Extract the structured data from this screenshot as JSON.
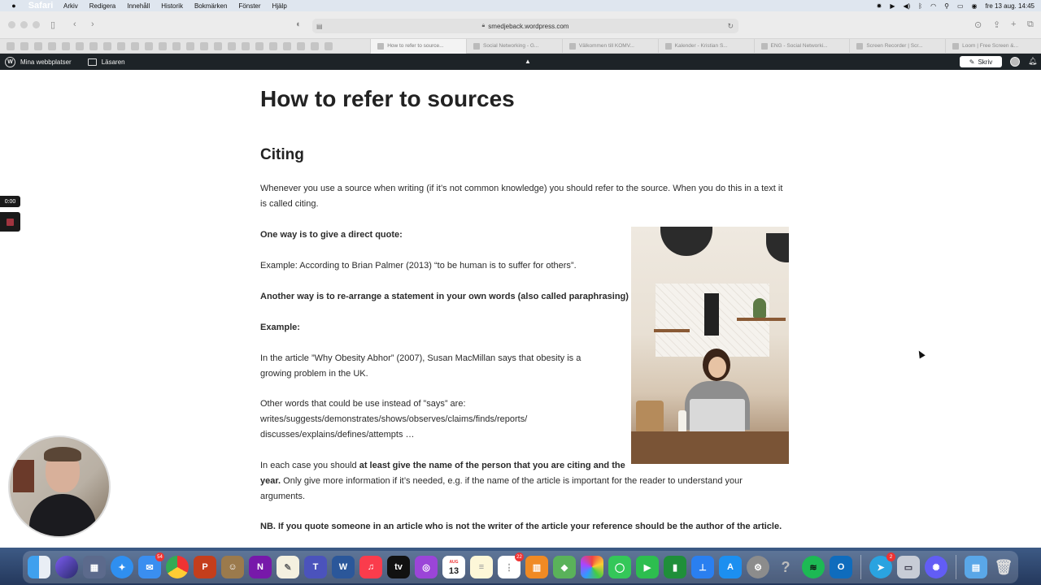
{
  "menubar": {
    "app_name": "Safari",
    "items": [
      "Arkiv",
      "Redigera",
      "Innehåll",
      "Historik",
      "Bokmärken",
      "Fönster",
      "Hjälp"
    ],
    "datetime": "fre 13 aug.  14:45"
  },
  "toolbar": {
    "url": "smedjeback.wordpress.com"
  },
  "tabs": [
    {
      "label": "How to refer to source...",
      "active": true
    },
    {
      "label": "Social Networking - G...",
      "active": false
    },
    {
      "label": "Välkommen till KOMV...",
      "active": false
    },
    {
      "label": "Kalender - Kristian S...",
      "active": false
    },
    {
      "label": "ENG - Social Networki...",
      "active": false
    },
    {
      "label": "Screen Recorder | Scr...",
      "active": false
    },
    {
      "label": "Loom | Free Screen &...",
      "active": false
    }
  ],
  "wpbar": {
    "my_sites": "Mina webbplatser",
    "reader": "Läsaren",
    "write": "Skriv"
  },
  "article": {
    "title": "How to refer to sources",
    "section": "Citing",
    "intro_line1": "Whenever you use a source when writing (if it’s not common knowledge) you should refer to the source. When you do this in a text it",
    "intro_line2": "is called citing.",
    "direct_quote_heading": "One way is to give a direct quote:",
    "direct_quote_example": "Example: According to Brian Palmer (2013) “to be human is to suffer for others”.",
    "paraphrase_heading": "Another way is to re-arrange a statement in your own words (also called paraphrasing)",
    "example_heading": "Example:",
    "paraphrase_line1": "In the article ”Why Obesity Abhor” (2007), Susan MacMillan says that obesity is a",
    "paraphrase_line2": "growing problem in the UK.",
    "other_words_line1": "Other words that could be use instead of ”says” are:",
    "other_words_line2": "writes/suggests/demonstrates/shows/observes/claims/finds/reports/",
    "other_words_line3": "discusses/explains/defines/attempts …",
    "each_case_lead": "In each case you should ",
    "each_case_bold1": "at least give the name of the person that you are citing and the",
    "each_case_bold2": "year.",
    "each_case_rest": " Only give more information if it’s needed, e.g. if the name of the article is important for the reader to understand your",
    "each_case_line3": "arguments.",
    "nb": "NB.  If you quote someone in an article who is not the writer of the article your reference should be the author of the article."
  },
  "recorder": {
    "timer": "0:00"
  },
  "dock": {
    "calendar_month": "AUG",
    "calendar_day": "13",
    "mail_badge": "54",
    "reminders_badge": "22",
    "telegram_badge": "2"
  }
}
